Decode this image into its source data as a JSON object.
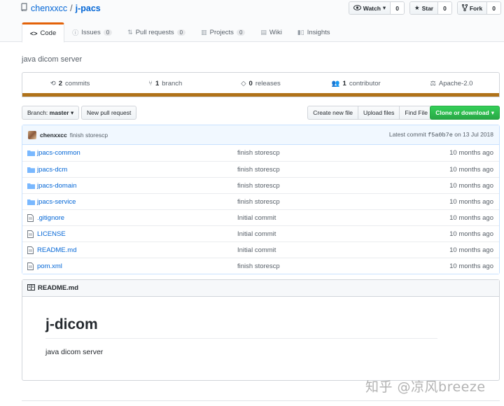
{
  "header": {
    "owner": "chenxxcc",
    "separator": "/",
    "repo": "j-pacs",
    "actions": {
      "watch": {
        "label": "Watch",
        "count": "0"
      },
      "star": {
        "label": "Star",
        "count": "0"
      },
      "fork": {
        "label": "Fork",
        "count": "0"
      }
    }
  },
  "nav": {
    "code": {
      "label": "Code"
    },
    "issues": {
      "label": "Issues",
      "count": "0"
    },
    "pulls": {
      "label": "Pull requests",
      "count": "0"
    },
    "projects": {
      "label": "Projects",
      "count": "0"
    },
    "wiki": {
      "label": "Wiki"
    },
    "insights": {
      "label": "Insights"
    }
  },
  "description": "java dicom server",
  "summary": {
    "commits": {
      "num": "2",
      "label": "commits"
    },
    "branches": {
      "num": "1",
      "label": "branch"
    },
    "releases": {
      "num": "0",
      "label": "releases"
    },
    "contributors": {
      "num": "1",
      "label": "contributor"
    },
    "license": "Apache-2.0",
    "language_color": "#b07219"
  },
  "toolbar": {
    "branch_prefix": "Branch:",
    "branch": "master",
    "new_pr": "New pull request",
    "create_file": "Create new file",
    "upload_files": "Upload files",
    "find_file": "Find File",
    "clone": "Clone or download"
  },
  "commit": {
    "author": "chenxxcc",
    "message": "finish storescp",
    "latest_prefix": "Latest commit",
    "sha": "f5a0b7e",
    "date": "on 13 Jul 2018"
  },
  "files": [
    {
      "name": "jpacs-common",
      "type": "dir",
      "message": "finish storescp",
      "age": "10 months ago"
    },
    {
      "name": "jpacs-dcm",
      "type": "dir",
      "message": "finish storescp",
      "age": "10 months ago"
    },
    {
      "name": "jpacs-domain",
      "type": "dir",
      "message": "finish storescp",
      "age": "10 months ago"
    },
    {
      "name": "jpacs-service",
      "type": "dir",
      "message": "finish storescp",
      "age": "10 months ago"
    },
    {
      "name": ".gitignore",
      "type": "file",
      "message": "Initial commit",
      "age": "10 months ago"
    },
    {
      "name": "LICENSE",
      "type": "file",
      "message": "Initial commit",
      "age": "10 months ago"
    },
    {
      "name": "README.md",
      "type": "file",
      "message": "Initial commit",
      "age": "10 months ago"
    },
    {
      "name": "pom.xml",
      "type": "file",
      "message": "finish storescp",
      "age": "10 months ago"
    }
  ],
  "readme": {
    "filename": "README.md",
    "heading": "j-dicom",
    "body": "java dicom server"
  },
  "watermark": "知乎 @凉风breeze"
}
